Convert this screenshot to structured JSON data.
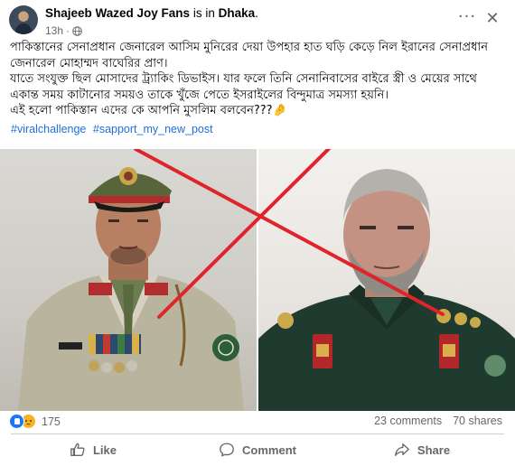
{
  "post": {
    "author": "Shajeeb Wazed Joy Fans",
    "location_prefix": "is in",
    "location": "Dhaka",
    "location_suffix": ".",
    "time": "13h",
    "time_separator": "·",
    "body": [
      "পাকিস্তানের সেনাপ্রধান জেনারেল আসিম মুনিরের দেয়া উপহার হাত ঘড়ি কেড়ে নিল ইরানের সেনাপ্রধান জেনারেল মোহাম্মদ বাঘেরির প্রাণ।",
      "যাতে সংযুক্ত ছিল মোসাদের ট্র্যাকিং ডিভাইস। যার ফলে তিনি সেনানিবাসের বাইরে স্ত্রী ও মেয়ের সাথে একান্ত সময় কাটানোর সময়ও তাকে খুঁজে পেতে ইসরাইলের বিন্দুমাত্র সমস্যা হয়নি।",
      "এই হলো পাকিস্তান এদের কে আপনি মুসলিম বলবেন???🤌"
    ],
    "hashtags": [
      "#viralchallenge",
      "#sapport_my_new_post"
    ]
  },
  "engagement": {
    "reaction_count": "175",
    "comments": "23 comments",
    "shares": "70 shares"
  },
  "actions": {
    "like": "Like",
    "comment": "Comment",
    "share": "Share"
  },
  "icons": [
    "globe-icon",
    "more-options-icon",
    "close-icon",
    "like-reaction-icon",
    "sad-reaction-icon",
    "like-icon",
    "comment-icon",
    "share-icon"
  ],
  "colors": {
    "hashtag": "#216fdb",
    "like_blue": "#1877f2",
    "muted_text": "#65676b",
    "cross_red": "#e0242b"
  }
}
